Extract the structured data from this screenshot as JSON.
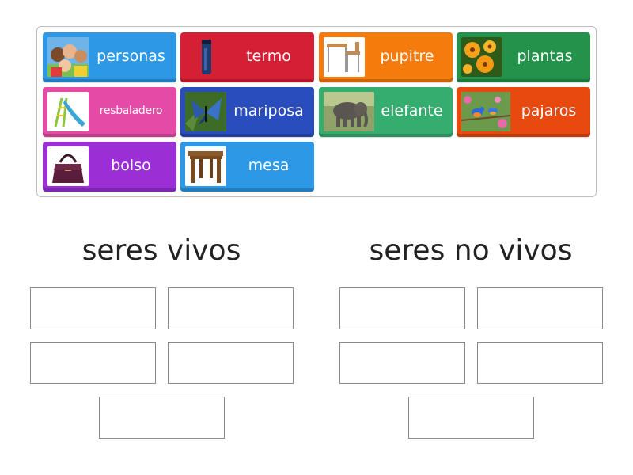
{
  "tiles": [
    {
      "label": "personas",
      "icon": "people-photo-icon"
    },
    {
      "label": "termo",
      "icon": "thermos-photo-icon"
    },
    {
      "label": "pupitre",
      "icon": "school-desk-photo-icon"
    },
    {
      "label": "plantas",
      "icon": "flowers-photo-icon"
    },
    {
      "label": "resbaladero",
      "icon": "slide-photo-icon"
    },
    {
      "label": "mariposa",
      "icon": "butterfly-photo-icon"
    },
    {
      "label": "elefante",
      "icon": "elephant-photo-icon"
    },
    {
      "label": "pajaros",
      "icon": "birds-photo-icon"
    },
    {
      "label": "bolso",
      "icon": "handbag-photo-icon"
    },
    {
      "label": "mesa",
      "icon": "table-photo-icon"
    }
  ],
  "groups": [
    {
      "title": "seres vivos"
    },
    {
      "title": "seres no vivos"
    }
  ],
  "colors": {
    "personas": "#2c98e6",
    "termo": "#d51f35",
    "pupitre": "#f47b0c",
    "plantas": "#23934b",
    "resbaladero": "#e64aa7",
    "mariposa": "#2a4dbd",
    "elefante": "#34ad6f",
    "pajaros": "#e8490f",
    "bolso": "#9a2fd6",
    "mesa": "#2c98e6"
  }
}
